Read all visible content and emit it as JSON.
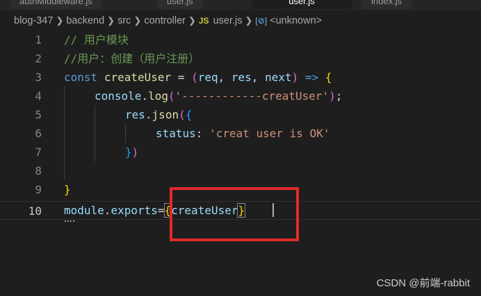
{
  "tabs": [
    {
      "label": "authMiddleware.js"
    },
    {
      "label": "user.js"
    },
    {
      "label": "user.js"
    },
    {
      "label": "index.js"
    }
  ],
  "breadcrumb": {
    "items": [
      "blog-347",
      "backend",
      "src",
      "controller"
    ],
    "js_badge": "JS",
    "file": "user.js",
    "symbol_icon": "symbol-variable-icon",
    "symbol": "<unknown>"
  },
  "editor": {
    "line_numbers": [
      "1",
      "2",
      "3",
      "4",
      "5",
      "6",
      "7",
      "8",
      "9",
      "10"
    ],
    "current_line": "10",
    "lines": {
      "l1": "// 用户模块",
      "l2": "//用户：创建（用户注册）",
      "l3_kw": "const",
      "l3_name": "createUser",
      "l3_eq": "=",
      "l3_p1": "(",
      "l3_req": "req",
      "l3_c1": ",",
      "l3_res": "res",
      "l3_c2": ",",
      "l3_next": "next",
      "l3_p2": ")",
      "l3_arrow": "=>",
      "l3_brace": "{",
      "l4_obj": "console",
      "l4_dot": ".",
      "l4_fn": "log",
      "l4_p1": "(",
      "l4_str": "'------------creatUser'",
      "l4_p2": ")",
      "l4_semi": ";",
      "l5_obj": "res",
      "l5_dot": ".",
      "l5_fn": "json",
      "l5_p": "(",
      "l5_b": "{",
      "l6_key": "status",
      "l6_colon": ":",
      "l6_str": "'creat user is OK'",
      "l7_b": "}",
      "l7_p": ")",
      "l9_b": "}",
      "l10_mod": "module",
      "l10_dot": ".",
      "l10_exp": "exports",
      "l10_eq": "=",
      "l10_b1": "{",
      "l10_name": "createUser",
      "l10_b2": "}"
    }
  },
  "watermark": "CSDN @前端-rabbit",
  "colors": {
    "background": "#1e1e1e",
    "keyword": "#569cd6",
    "function": "#dcdcaa",
    "variable": "#9cdcfe",
    "string": "#ce9178",
    "comment": "#6a9955",
    "highlight_box": "#e02a2a"
  }
}
